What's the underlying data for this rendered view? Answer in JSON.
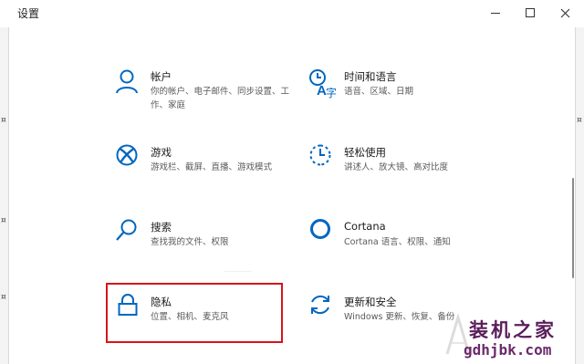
{
  "window": {
    "title": "设置"
  },
  "colors": {
    "accent": "#0067c0",
    "highlight": "#d4161c",
    "watermark": "#5a1e5a"
  },
  "tiles": [
    {
      "name": "帐户",
      "desc": "你的帐户、电子邮件、同步设置、工作、家庭",
      "icon": "person-icon"
    },
    {
      "name": "时间和语言",
      "desc": "语音、区域、日期",
      "icon": "time-language-icon"
    },
    {
      "name": "游戏",
      "desc": "游戏栏、截屏、直播、游戏模式",
      "icon": "xbox-icon"
    },
    {
      "name": "轻松使用",
      "desc": "讲述人、放大镜、高对比度",
      "icon": "ease-of-access-icon"
    },
    {
      "name": "搜索",
      "desc": "查找我的文件、权限",
      "icon": "search-icon"
    },
    {
      "name": "Cortana",
      "desc": "Cortana 语言、权限、通知",
      "icon": "cortana-icon"
    },
    {
      "name": "隐私",
      "desc": "位置、相机、麦克风",
      "icon": "lock-icon"
    },
    {
      "name": "更新和安全",
      "desc": "Windows 更新、恢复、备份",
      "icon": "update-icon"
    }
  ],
  "watermark": {
    "title": "装机之家",
    "url": "gdhjbk.com"
  }
}
